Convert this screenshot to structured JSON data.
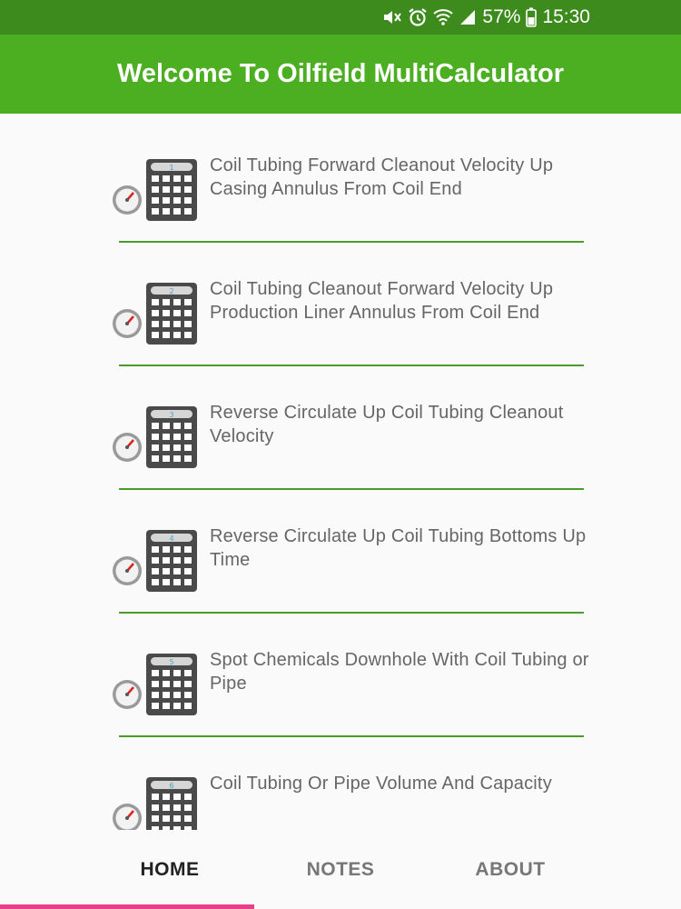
{
  "status_bar": {
    "battery_percent": "57%",
    "time": "15:30",
    "icons": [
      "mute-icon",
      "alarm-icon",
      "wifi-icon",
      "signal-icon",
      "battery-icon"
    ]
  },
  "app_bar": {
    "title": "Welcome To Oilfield MultiCalculator"
  },
  "list": {
    "items": [
      {
        "number": "1",
        "label": "Coil Tubing Forward Cleanout Velocity Up Casing Annulus From Coil End"
      },
      {
        "number": "2",
        "label": "Coil Tubing Cleanout Forward Velocity Up Production Liner Annulus From Coil End"
      },
      {
        "number": "3",
        "label": "Reverse Circulate Up Coil Tubing Cleanout Velocity"
      },
      {
        "number": "4",
        "label": "Reverse Circulate Up Coil Tubing Bottoms Up Time"
      },
      {
        "number": "5",
        "label": "Spot Chemicals Downhole With Coil Tubing or Pipe"
      },
      {
        "number": "6",
        "label": "Coil Tubing Or Pipe Volume And Capacity"
      }
    ]
  },
  "bottom_nav": {
    "tabs": [
      {
        "label": "HOME",
        "active": true
      },
      {
        "label": "NOTES",
        "active": false
      },
      {
        "label": "ABOUT",
        "active": false
      }
    ]
  },
  "colors": {
    "status_bar": "#3c8b1c",
    "app_bar": "#4caf22",
    "divider": "#4a9b2a",
    "tab_indicator": "#e83e8c",
    "item_text": "#666666"
  }
}
